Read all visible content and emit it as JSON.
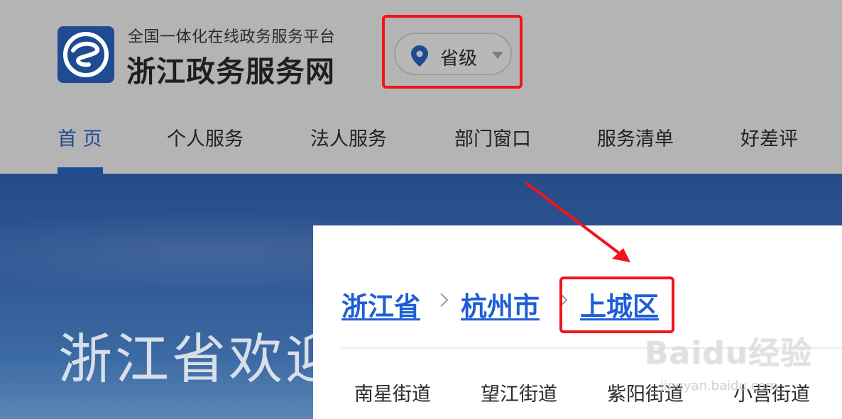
{
  "header": {
    "site_subtitle": "全国一体化在线政务服务平台",
    "site_title": "浙江政务服务网",
    "logo_icon": "zhejiang-gov-logo",
    "region_selector": {
      "label": "省级",
      "icon": "location-pin-icon"
    }
  },
  "nav": {
    "items": [
      {
        "label": "首 页",
        "active": true
      },
      {
        "label": "个人服务"
      },
      {
        "label": "法人服务"
      },
      {
        "label": "部门窗口"
      },
      {
        "label": "服务清单"
      },
      {
        "label": "好差评"
      }
    ]
  },
  "banner": {
    "text": "浙江省欢迎"
  },
  "region_popup": {
    "breadcrumb": [
      "浙江省",
      "杭州市",
      "上城区"
    ],
    "streets": [
      "南星街道",
      "望江街道",
      "紫阳街道",
      "小营街道"
    ]
  },
  "watermark": {
    "brand": "Baidu经验",
    "url": "jingyan.baidu.com"
  },
  "colors": {
    "brand_blue": "#1e4b92",
    "link_blue": "#1e5ed6",
    "highlight_red": "#f3131a",
    "overlay_gray": "#b4b4b4"
  }
}
